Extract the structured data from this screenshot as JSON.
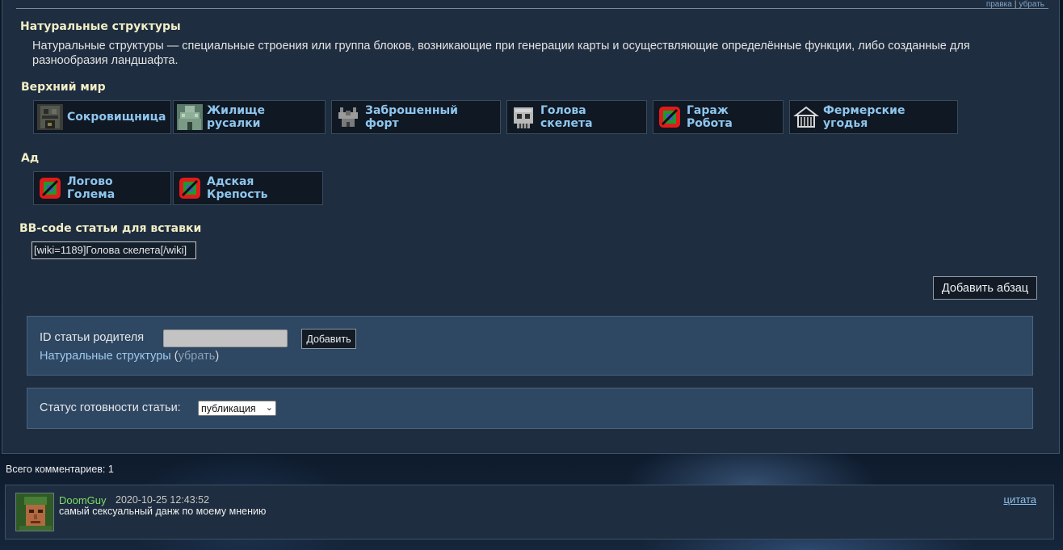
{
  "edit_links": {
    "edit": "правка",
    "separator": "|",
    "remove": "убрать"
  },
  "article": {
    "title": "Натуральные структуры",
    "description": "Натуральные структуры — специальные строения или группа блоков, возникающие при генерации карты и осуществляющие определённые функции, либо созданные для разнообразия ландшафта."
  },
  "sections": [
    {
      "heading": "Верхний мир",
      "items": [
        {
          "label": "Сокровищница",
          "icon": "treasury-icon"
        },
        {
          "label": "Жилище русалки",
          "icon": "mermaid-dwelling-icon"
        },
        {
          "label": "Заброшенный форт",
          "icon": "abandoned-fort-icon"
        },
        {
          "label": "Голова скелета",
          "icon": "skeleton-head-icon"
        },
        {
          "label": "Гараж Робота",
          "icon": "no-image-icon"
        },
        {
          "label": "Фермерские угодья",
          "icon": "farmland-icon"
        }
      ]
    },
    {
      "heading": "Ад",
      "items": [
        {
          "label": "Логово Голема",
          "icon": "no-image-icon"
        },
        {
          "label": "Адская Крепость",
          "icon": "no-image-icon"
        }
      ]
    }
  ],
  "bbcode": {
    "heading": "BB-code статьи для вставки",
    "value": "[wiki=1189]Голова скелета[/wiki]"
  },
  "add_paragraph_label": "Добавить абзац",
  "parent": {
    "label": "ID статьи родителя",
    "input_value": "",
    "add_label": "Добавить",
    "link_text": "Натуральные структуры",
    "open_paren": "(",
    "remove_text": "убрать",
    "close_paren": ")"
  },
  "status": {
    "label": "Статус готовности статьи:",
    "selected": "публикация"
  },
  "comments": {
    "count_label": "Всего комментариев: 1",
    "items": [
      {
        "user": "DoomGuy",
        "date": "2020-10-25 12:43:52",
        "text": "самый сексуальный данж по моему мнению",
        "quote_label": "цитата"
      }
    ]
  },
  "colors": {
    "panel_bg": "#1e2d3f",
    "heading": "#f1eec6",
    "link": "#8fc6ee",
    "box_bg": "#2e4762",
    "username": "#7ddd68"
  }
}
